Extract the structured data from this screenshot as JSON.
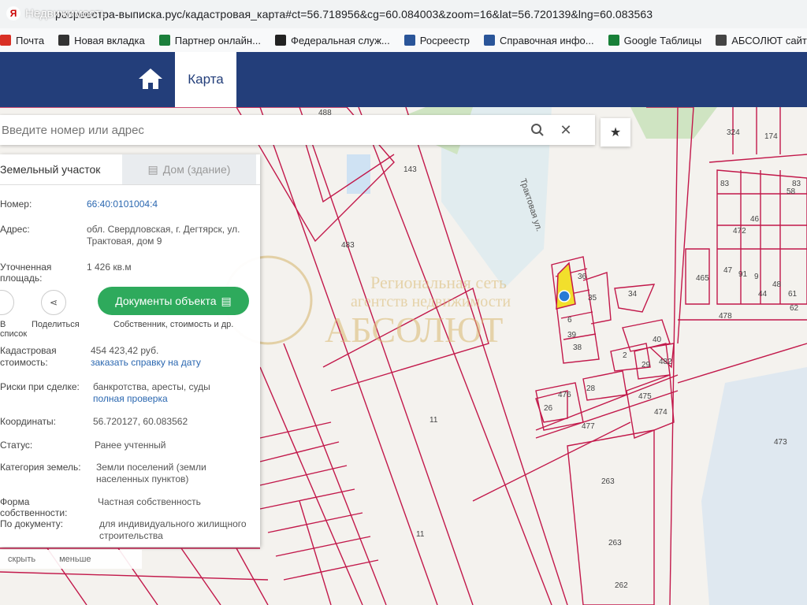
{
  "browser": {
    "watermark": "Недвижимость",
    "url": "росреестра-выписка.рус/кадастровая_карта#ct=56.718956&cg=60.084003&zoom=16&lat=56.720139&lng=60.083563",
    "bookmarks": [
      {
        "label": "Почта",
        "icon": "mail-icon",
        "color": "#d93025"
      },
      {
        "label": "Новая вкладка",
        "icon": "globe-icon",
        "color": "#333333"
      },
      {
        "label": "Партнер онлайн...",
        "icon": "house-icon",
        "color": "#1b7f3b"
      },
      {
        "label": "Федеральная служ...",
        "icon": "ru-icon",
        "color": "#222222"
      },
      {
        "label": "Росреестр",
        "icon": "rosreestr-icon",
        "color": "#2a5599"
      },
      {
        "label": "Справочная инфо...",
        "icon": "rosreestr-icon",
        "color": "#2a5599"
      },
      {
        "label": "Google Таблицы",
        "icon": "sheets-icon",
        "color": "#188038"
      },
      {
        "label": "АБСОЛЮТ сайт",
        "icon": "site-icon",
        "color": "#444444"
      }
    ]
  },
  "nav": {
    "tab_map": "Карта"
  },
  "search": {
    "placeholder": "Введите номер или адрес"
  },
  "panel": {
    "tab_land": "Земельный участок",
    "tab_house": "Дом (здание)",
    "number_label": "Номер:",
    "number_value": "66:40:0101004:4",
    "address_label": "Адрес:",
    "address_value": "обл. Свердловская, г. Дегтярск, ул. Трактовая, дом 9",
    "area_label": "Уточненная площадь:",
    "area_value": "1 426 кв.м",
    "fav_label": "В список",
    "share_label": "Поделиться",
    "docs_button": "Документы объекта",
    "docs_sub": "Собственник, стоимость и др.",
    "cadastral_label": "Кадастровая стоимость:",
    "cadastral_value": "454 423,42 руб.",
    "cadastral_link": "заказать справку на дату",
    "risks_label": "Риски при сделке:",
    "risks_value": "банкротства, аресты, суды",
    "risks_link": "полная проверка",
    "coords_label": "Координаты:",
    "coords_value": "56.720127, 60.083562",
    "status_label": "Статус:",
    "status_value": "Ранее учтенный",
    "category_label": "Категория земель:",
    "category_value": "Земли поселений (земли населенных пунктов)",
    "ownership_label": "Форма собственности:",
    "ownership_value": "Частная собственность",
    "use_label": "По документу:",
    "use_value": "для индивидуального жилищного строительства",
    "hide_label": "скрыть",
    "less_label": "меньше"
  },
  "map": {
    "street": "Трактовая ул.",
    "watermark_line1": "Региональная сеть",
    "watermark_line2": "агентств недвижимости",
    "watermark_brand": "АБСОЛЮТ",
    "parcel_numbers": [
      "488",
      "483",
      "143",
      "11",
      "11",
      "477",
      "476",
      "478",
      "474",
      "475",
      "473",
      "263",
      "263",
      "262",
      "36",
      "35",
      "34",
      "6",
      "39",
      "38",
      "40",
      "2",
      "29",
      "482",
      "28",
      "26",
      "465",
      "47",
      "91",
      "9",
      "44",
      "48",
      "61",
      "62",
      "83",
      "46",
      "472",
      "324",
      "174",
      "83",
      "58"
    ]
  },
  "colors": {
    "navbar": "#233e7a",
    "accent_green": "#2eaa5c",
    "parcel_line": "#c2184a",
    "link": "#2a67b0"
  }
}
